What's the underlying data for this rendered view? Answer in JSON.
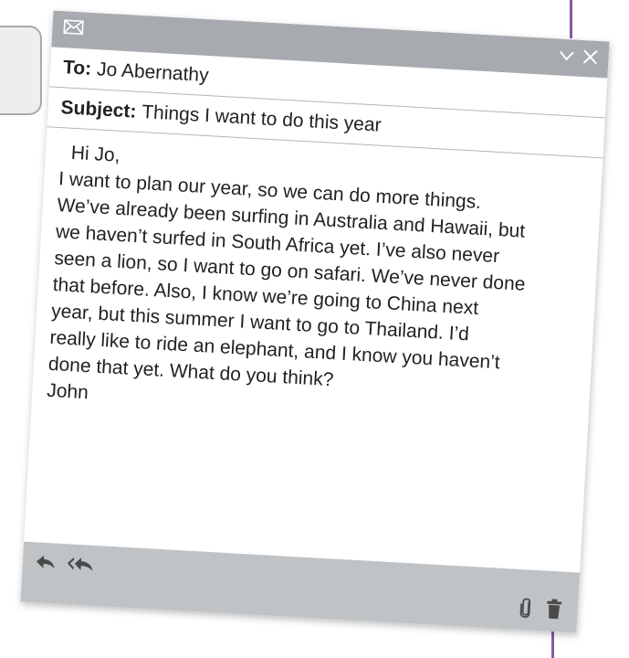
{
  "email": {
    "to_label": "To:",
    "to_value": "Jo Abernathy",
    "subject_label": "Subject:",
    "subject_value": "Things I want to do this year",
    "greeting": "Hi Jo,",
    "body_lines": [
      "I want to plan our year, so we can do more things.",
      "We’ve already been surfing in Australia and Hawaii, but",
      "we haven’t surfed in South Africa yet. I’ve also never",
      "seen a lion, so I want to go on safari. We’ve never done",
      "that before. Also, I know we’re going to China next",
      "year, but this summer I want to go to Thailand. I’d",
      "really like to ride an elephant, and I know you haven’t",
      "done that yet. What do you think?"
    ],
    "signature": "John"
  },
  "icons": {
    "title": [
      "mail-icon",
      "chevron-down-icon",
      "close-icon"
    ],
    "toolbar": [
      "reply-icon",
      "reply-all-icon",
      "paperclip-icon",
      "trash-icon"
    ]
  },
  "colors": {
    "title_bar": "#a7abaf",
    "bottom_bar": "#bfc3c6",
    "accent_line": "#8a5a9e"
  }
}
